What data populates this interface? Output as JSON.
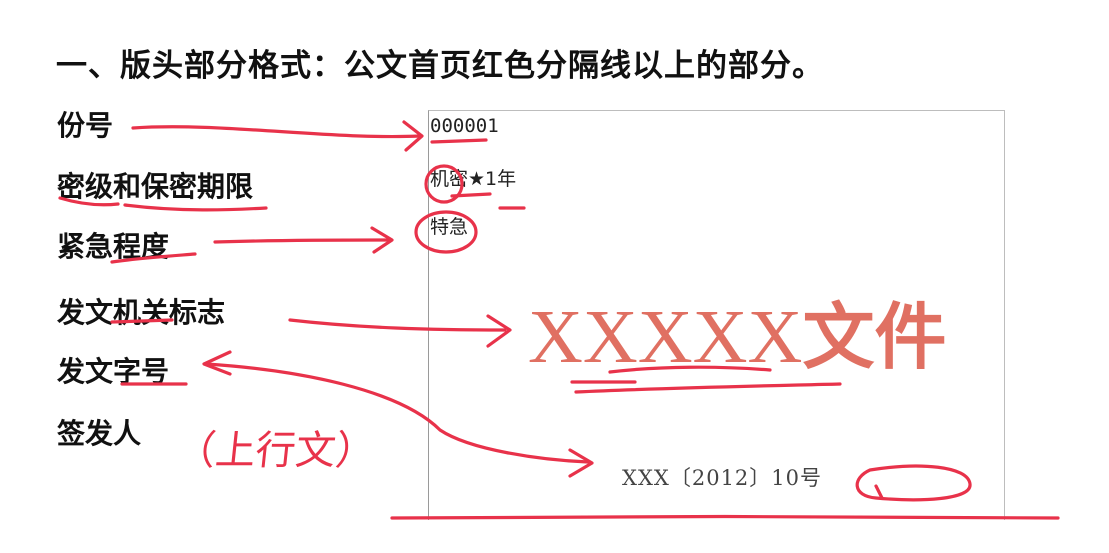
{
  "heading": "一、版头部分格式：公文首页红色分隔线以上的部分。",
  "labels": {
    "copy_number": "份号",
    "secrecy": "密级和保密期限",
    "urgency": "紧急程度",
    "issuer_mark": "发文机关标志",
    "doc_number": "发文字号",
    "signer": "签发人"
  },
  "handwritten_note": "（上行文）",
  "document": {
    "copy_number": "000001",
    "secrecy": "机密★1年",
    "urgency": "特急",
    "issuer_name": "XXXXX",
    "issuer_suffix": "文件",
    "doc_number": "XXX〔2012〕10号"
  },
  "colors": {
    "annotation_ink": "#e8324a",
    "issuer_red": "#e07062"
  }
}
